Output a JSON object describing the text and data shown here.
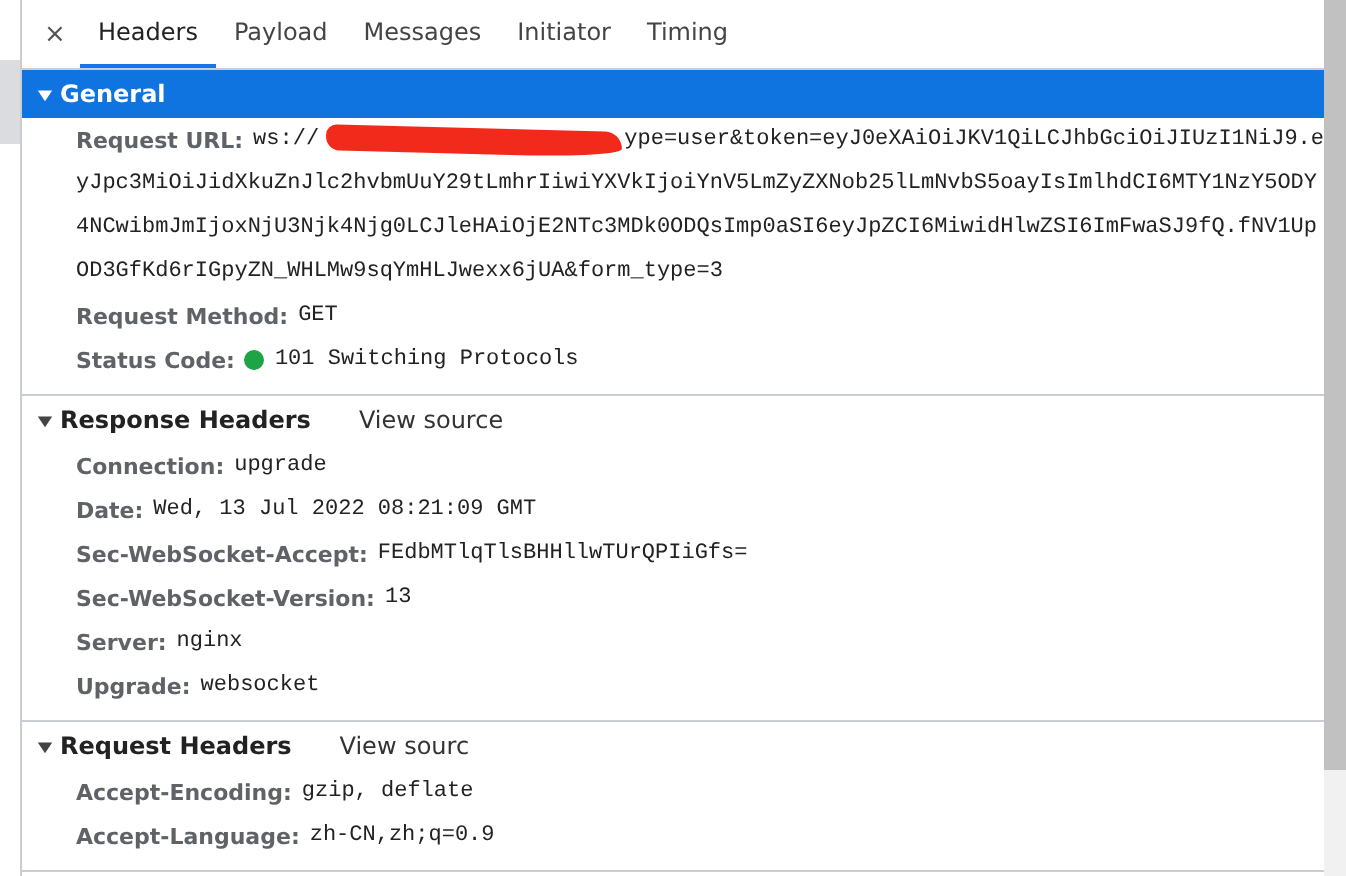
{
  "tabs": [
    {
      "label": "Headers",
      "selected": true
    },
    {
      "label": "Payload",
      "selected": false
    },
    {
      "label": "Messages",
      "selected": false
    },
    {
      "label": "Initiator",
      "selected": false
    },
    {
      "label": "Timing",
      "selected": false
    }
  ],
  "close": "×",
  "sections": [
    {
      "title": "General",
      "expanded": true,
      "selected": true,
      "rows": [
        {
          "kind": "url",
          "name": "Request URL:",
          "value": "ws://",
          "redacted": true,
          "lines": [
            "ype=user&token=eyJ0eXAiOiJKV1QiLCJhbGciOiJIUzI1NiJ9.e",
            "yJpc3MiOiJidXkuZnJlc2hvbmUuY29tLmhrIiwiYXVkIjoiYnV5LmZyZXNob25lLmNvbS5oayIsImlhdCI6MTY1NzY5ODY",
            "4NCwibmJmIjoxNjU3Njk4Njg0LCJleHAiOjE2NTc3MDk0ODQsImp0aSI6eyJpZCI6MiwidHlwZSI6ImFwaSJ9fQ.fNV1Up",
            "OD3GfKd6rIGpyZN_WHLMw9sqYmHLJwexx6jUA&form_type=3"
          ]
        },
        {
          "kind": "plain",
          "name": "Request Method:",
          "value": "GET"
        },
        {
          "kind": "status",
          "name": "Status Code:",
          "value": "101 Switching Protocols",
          "color": "#1ea446"
        }
      ]
    },
    {
      "title": "Response Headers",
      "expanded": true,
      "selected": false,
      "link": "View source",
      "rows": [
        {
          "kind": "plain",
          "name": "Connection:",
          "value": "upgrade"
        },
        {
          "kind": "plain",
          "name": "Date:",
          "value": "Wed, 13 Jul 2022 08:21:09 GMT"
        },
        {
          "kind": "plain",
          "name": "Sec-WebSocket-Accept:",
          "value": "FEdbMTlqTlsBHHllwTUrQPIiGfs="
        },
        {
          "kind": "plain",
          "name": "Sec-WebSocket-Version:",
          "value": "13"
        },
        {
          "kind": "plain",
          "name": "Server:",
          "value": "nginx"
        },
        {
          "kind": "plain",
          "name": "Upgrade:",
          "value": "websocket"
        }
      ]
    },
    {
      "title": "Request Headers",
      "expanded": true,
      "selected": false,
      "link": "View sourc",
      "rows": [
        {
          "kind": "plain",
          "name": "Accept-Encoding:",
          "value": "gzip, deflate"
        },
        {
          "kind": "plain",
          "name": "Accept-Language:",
          "value": "zh-CN,zh;q=0.9"
        }
      ]
    }
  ]
}
